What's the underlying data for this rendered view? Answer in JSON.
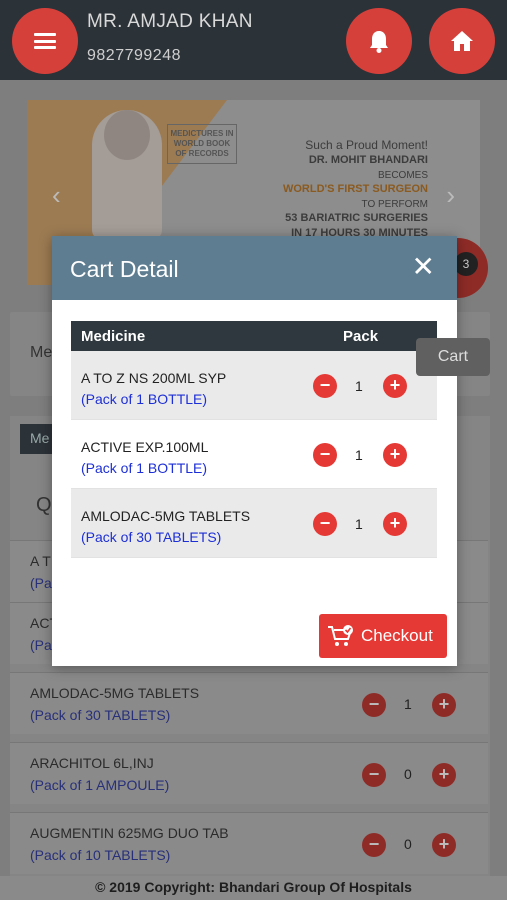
{
  "header": {
    "user_name": "MR. AMJAD KHAN",
    "phone": "9827799248"
  },
  "banner": {
    "record_badge": "MEDICTURES IN WORLD BOOK OF RECORDS",
    "line1": "Such a Proud Moment!",
    "line2": "DR. MOHIT BHANDARI",
    "line3": "BECOMES",
    "line4": "WORLD'S FIRST SURGEON",
    "line5": "TO PERFORM",
    "line6": "53 BARIATRIC SURGERIES",
    "line7": "IN 17 HOURS 30 MINUTES"
  },
  "background": {
    "search_label": "Me",
    "tab_label": "Me",
    "qty_label": "Q",
    "cart_count": "3",
    "cart_tooltip": "Cart",
    "rows": [
      {
        "name": "A T",
        "pack": "(Pa",
        "qty": ""
      },
      {
        "name": "ACT",
        "pack": "(Pa",
        "qty": ""
      },
      {
        "name": "AMLODAC-5MG TABLETS",
        "pack": "(Pack of 30 TABLETS)",
        "qty": "1"
      },
      {
        "name": "ARACHITOL 6L,INJ",
        "pack": "(Pack of 1 AMPOULE)",
        "qty": "0"
      },
      {
        "name": "AUGMENTIN 625MG DUO TAB",
        "pack": "(Pack of 10 TABLETS)",
        "qty": "0"
      }
    ]
  },
  "modal": {
    "title": "Cart Detail",
    "columns": [
      "Medicine",
      "Pack"
    ],
    "items": [
      {
        "name": "A TO Z NS 200ML SYP",
        "pack": "(Pack of 1 BOTTLE)",
        "qty": "1"
      },
      {
        "name": "ACTIVE EXP.100ML",
        "pack": "(Pack of 1 BOTTLE)",
        "qty": "1"
      },
      {
        "name": "AMLODAC-5MG TABLETS",
        "pack": "(Pack of 30 TABLETS)",
        "qty": "1"
      }
    ],
    "checkout_label": "Checkout"
  },
  "footer": {
    "copyright": "© 2019 Copyright: Bhandari Group Of Hospitals"
  },
  "colors": {
    "accent_red": "#e53935",
    "header_dark": "#2b3238",
    "modal_header": "#5e7d91",
    "pack_blue": "#1d2fd6"
  },
  "icons": [
    "menu-icon",
    "bell-icon",
    "home-icon",
    "close-icon",
    "minus-icon",
    "plus-icon",
    "cart-check-icon",
    "cart-icon"
  ]
}
